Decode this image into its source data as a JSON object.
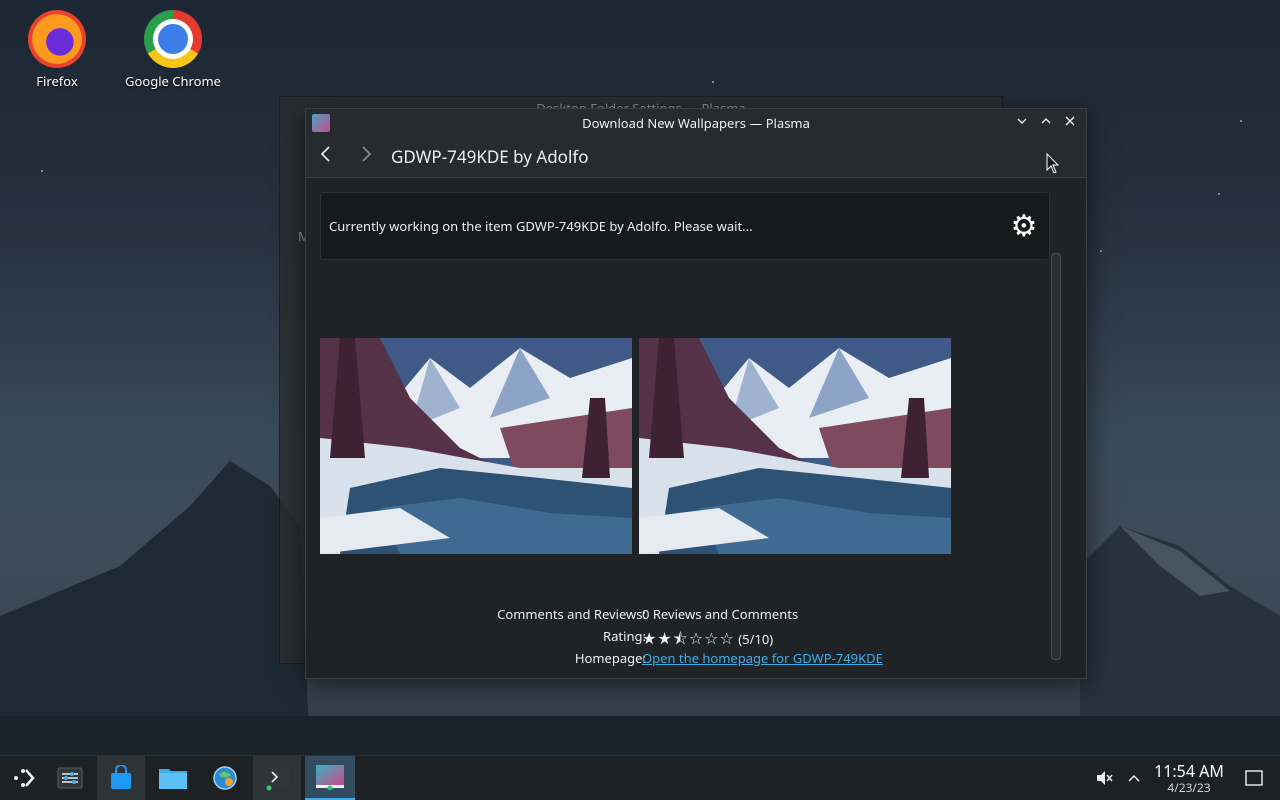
{
  "desktop": {
    "icons": [
      {
        "label": "Firefox"
      },
      {
        "label": "Google Chrome"
      }
    ]
  },
  "background_window": {
    "title": "Desktop Folder Settings — Plasma",
    "partial_label": "M"
  },
  "window": {
    "title": "Download New Wallpapers — Plasma",
    "heading": "GDWP-749KDE by Adolfo",
    "status_message": "Currently working on the item GDWP-749KDE by Adolfo. Please wait...",
    "details": {
      "comments_label": "Comments and Reviews:",
      "comments_value": "0 Reviews and Comments",
      "rating_label": "Rating:",
      "rating_stars": "★★⯪☆☆☆",
      "rating_value": "(5/10)",
      "rating": 0.5,
      "homepage_label": "Homepage:",
      "homepage_link": "Open the homepage for GDWP-749KDE"
    },
    "icons": {
      "back": "chevron-left-icon",
      "forward": "chevron-right-icon",
      "minimize": "chevron-down-icon",
      "maximize": "chevron-up-icon",
      "close": "close-icon",
      "busy": "gear-icon"
    }
  },
  "taskbar": {
    "apps": [
      "application-launcher",
      "system-settings",
      "discover",
      "dolphin",
      "system-settings-globe",
      "konsole",
      "download-new-wallpapers"
    ],
    "clock": {
      "time": "11:54 AM",
      "date": "4/23/23"
    }
  },
  "colors": {
    "accent": "#3daee9",
    "window_bg": "#202326",
    "titlebar_bg": "#272a2e",
    "taskbar_bg": "#1e2124"
  }
}
